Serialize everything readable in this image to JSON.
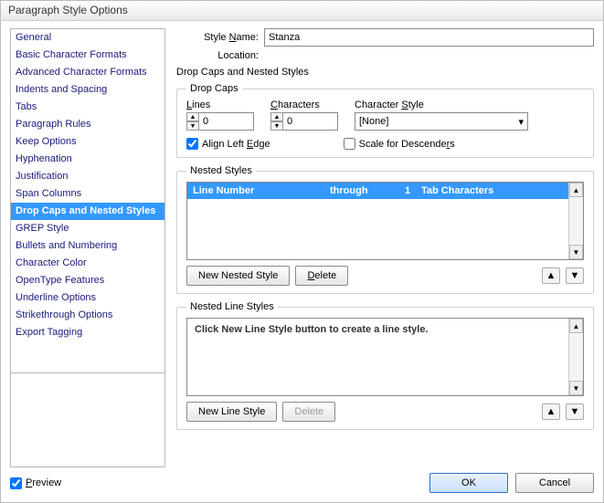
{
  "window_title": "Paragraph Style Options",
  "sidebar": {
    "items": [
      "General",
      "Basic Character Formats",
      "Advanced Character Formats",
      "Indents and Spacing",
      "Tabs",
      "Paragraph Rules",
      "Keep Options",
      "Hyphenation",
      "Justification",
      "Span Columns",
      "Drop Caps and Nested Styles",
      "GREP Style",
      "Bullets and Numbering",
      "Character Color",
      "OpenType Features",
      "Underline Options",
      "Strikethrough Options",
      "Export Tagging"
    ],
    "selected_index": 10
  },
  "style_name_label": "Style Name:",
  "style_name_value": "Stanza",
  "location_label": "Location:",
  "panel_title": "Drop Caps and Nested Styles",
  "drop_caps": {
    "legend": "Drop Caps",
    "lines_label": "Lines",
    "lines_value": "0",
    "chars_label": "Characters",
    "chars_value": "0",
    "charstyle_label": "Character Style",
    "charstyle_value": "[None]",
    "align_left_checked": true,
    "align_left_label": "Align Left Edge",
    "scale_desc_checked": false,
    "scale_desc_label": "Scale for Descenders"
  },
  "nested_styles": {
    "legend": "Nested Styles",
    "row": {
      "c1": "Line Number",
      "c2": "through",
      "c3": "1",
      "c4": "Tab Characters"
    },
    "new_btn": "New Nested Style",
    "delete_btn": "Delete"
  },
  "nested_line_styles": {
    "legend": "Nested Line Styles",
    "hint": "Click New Line Style button to create a line style.",
    "new_btn": "New Line Style",
    "delete_btn": "Delete"
  },
  "footer": {
    "preview_checked": true,
    "preview_label": "Preview",
    "ok": "OK",
    "cancel": "Cancel"
  }
}
